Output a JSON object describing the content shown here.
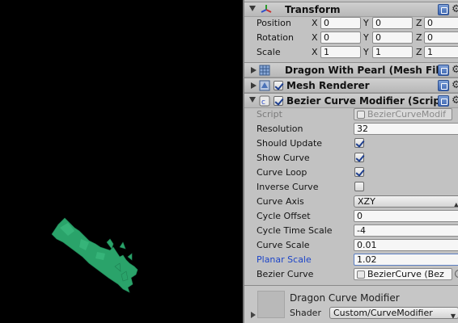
{
  "transform": {
    "title": "Transform",
    "rows": [
      {
        "label": "Position",
        "x": "0",
        "y": "0",
        "z": "0"
      },
      {
        "label": "Rotation",
        "x": "0",
        "y": "0",
        "z": "0"
      },
      {
        "label": "Scale",
        "x": "1",
        "y": "1",
        "z": "1"
      }
    ],
    "axis_x": "X",
    "axis_y": "Y",
    "axis_z": "Z"
  },
  "mesh_filter": {
    "title": "Dragon With Pearl (Mesh Filt"
  },
  "mesh_renderer": {
    "title": "Mesh Renderer",
    "enabled": true
  },
  "bezier": {
    "title": "Bezier Curve Modifier (Script",
    "enabled": true,
    "script_label": "Script",
    "script_value": "BezierCurveModif",
    "resolution_label": "Resolution",
    "resolution_value": "32",
    "should_update_label": "Should Update",
    "should_update": true,
    "show_curve_label": "Show Curve",
    "show_curve": true,
    "curve_loop_label": "Curve Loop",
    "curve_loop": true,
    "inverse_curve_label": "Inverse Curve",
    "inverse_curve": false,
    "curve_axis_label": "Curve Axis",
    "curve_axis_value": "XZY",
    "cycle_offset_label": "Cycle Offset",
    "cycle_offset_value": "0",
    "cycle_time_scale_label": "Cycle Time Scale",
    "cycle_time_scale_value": "-4",
    "curve_scale_label": "Curve Scale",
    "curve_scale_value": "0.01",
    "planar_scale_label": "Planar Scale",
    "planar_scale_value": "1.02",
    "bezier_curve_label": "Bezier Curve",
    "bezier_curve_value": "BezierCurve (Bez"
  },
  "material": {
    "name": "Dragon Curve Modifier",
    "shader_label": "Shader",
    "shader_value": "Custom/CurveModifier"
  },
  "colors": {
    "scene_bg": "#000000",
    "dragon": "#2aa36a",
    "inspector_bg": "#c2c2c2",
    "modified_label": "#1d45c8"
  }
}
